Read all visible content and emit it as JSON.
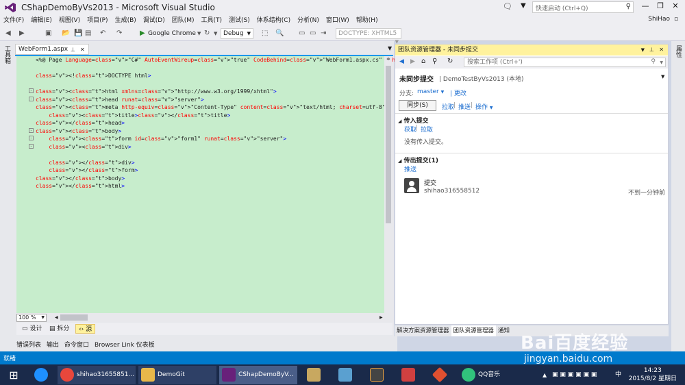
{
  "window": {
    "title": "CShapDemoByVs2013 - Microsoft Visual Studio",
    "quick_launch_placeholder": "快速启动 (Ctrl+Q)",
    "user": "ShiHao"
  },
  "menu": [
    "文件(F)",
    "编辑(E)",
    "视图(V)",
    "项目(P)",
    "生成(B)",
    "调试(D)",
    "团队(M)",
    "工具(T)",
    "测试(S)",
    "体系结构(C)",
    "分析(N)",
    "窗口(W)",
    "帮助(H)"
  ],
  "toolbar": {
    "run_target": "Google Chrome",
    "config": "Debug",
    "doctype": "DOCTYPE: XHTML5"
  },
  "left_tabs": [
    "工具箱"
  ],
  "right_tabs": [
    "属性"
  ],
  "editor": {
    "tab_label": "WebForm1.aspx",
    "code_lines": [
      {
        "text": "<%@ Page Language=\"C#\" AutoEventWireup=\"true\" CodeBehind=\"WebForm1.aspx.cs\" Inherits=\"CShapDemoByVs",
        "fold": ""
      },
      {
        "text": "",
        "fold": ""
      },
      {
        "text": "<!DOCTYPE html>",
        "fold": ""
      },
      {
        "text": "",
        "fold": ""
      },
      {
        "text": "<html xmlns=\"http://www.w3.org/1999/xhtml\">",
        "fold": "-"
      },
      {
        "text": "<head runat=\"server\">",
        "fold": "-"
      },
      {
        "text": "<meta http-equiv=\"Content-Type\" content=\"text/html; charset=utf-8\"/>",
        "fold": ""
      },
      {
        "text": "    <title></title>",
        "fold": ""
      },
      {
        "text": "</head>",
        "fold": ""
      },
      {
        "text": "<body>",
        "fold": "-"
      },
      {
        "text": "    <form id=\"form1\" runat=\"server\">",
        "fold": "-"
      },
      {
        "text": "    <div>",
        "fold": "-"
      },
      {
        "text": "",
        "fold": ""
      },
      {
        "text": "    </div>",
        "fold": ""
      },
      {
        "text": "    </form>",
        "fold": ""
      },
      {
        "text": "</body>",
        "fold": ""
      },
      {
        "text": "</html>",
        "fold": ""
      }
    ],
    "zoom": "100 %",
    "view_design": "设计",
    "view_split": "拆分",
    "view_source": "源"
  },
  "bottom_panes": [
    "错误列表",
    "输出",
    "命令窗口",
    "Browser Link 仪表板"
  ],
  "team_explorer": {
    "title": "团队资源管理器 - 未同步提交",
    "search_placeholder": "搜索工作项 (Ctrl+')",
    "heading": "未同步提交",
    "repo": "DemoTestByVs2013 (本地)",
    "branch_label": "分支:",
    "branch": "master",
    "change_link": "更改",
    "sync_button": "同步(S)",
    "pull_link": "拉取",
    "push_link": "推送",
    "actions_link": "操作",
    "incoming_header": "传入提交",
    "fetch_link": "获取",
    "incoming_pull_link": "拉取",
    "no_incoming": "没有传入提交。",
    "outgoing_header": "传出提交(1)",
    "outgoing_push_link": "推送",
    "commit_title": "提交",
    "commit_author": "shihao316558512",
    "commit_time": "不到一分钟前",
    "bottom_tabs": [
      "解决方案资源管理器",
      "团队资源管理器",
      "通知"
    ]
  },
  "status": "就绪",
  "taskbar": {
    "items": [
      "shihao31655851...",
      "DemoGit",
      "CShapDemoByV...",
      "QQ音乐"
    ],
    "time": "14:23",
    "date": "2015/8/2 星期日",
    "ime": "中"
  },
  "watermark": {
    "brand": "Bai百度经验",
    "url": "jingyan.baidu.com"
  },
  "colors": {
    "accent": "#007acc",
    "editor_bg": "#c7edcc",
    "panel_title_bg": "#fff29d",
    "link": "#1e6fd0"
  }
}
